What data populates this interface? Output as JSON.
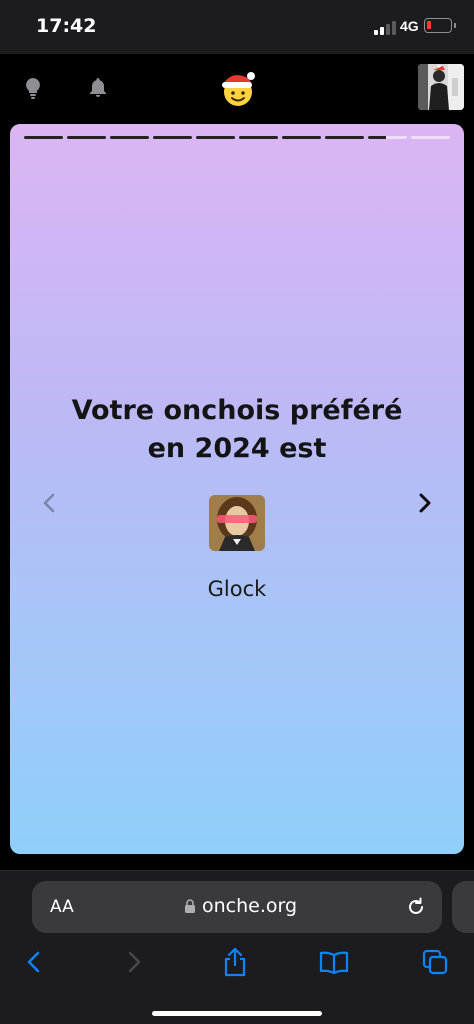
{
  "status_bar": {
    "time": "17:42",
    "network": "4G"
  },
  "header": {
    "left_icons": [
      "lightbulb-icon",
      "bell-icon"
    ],
    "logo": "santa-smiley-logo",
    "profile": "user-avatar"
  },
  "story": {
    "segments_total": 10,
    "segments_done": 8,
    "current_progress": 0.45,
    "title": "Votre onchois préféré en 2024 est",
    "pick_name": "Glock"
  },
  "browser": {
    "aa_label": "AA",
    "url": "onche.org",
    "toolbar": [
      "back-icon",
      "forward-icon",
      "share-icon",
      "bookmarks-icon",
      "tabs-icon"
    ]
  },
  "colors": {
    "gradient_top": "#dcb5f3",
    "gradient_bottom": "#8fcff9",
    "accent_blue": "#0a84ff",
    "battery_low": "#ff3b30"
  }
}
